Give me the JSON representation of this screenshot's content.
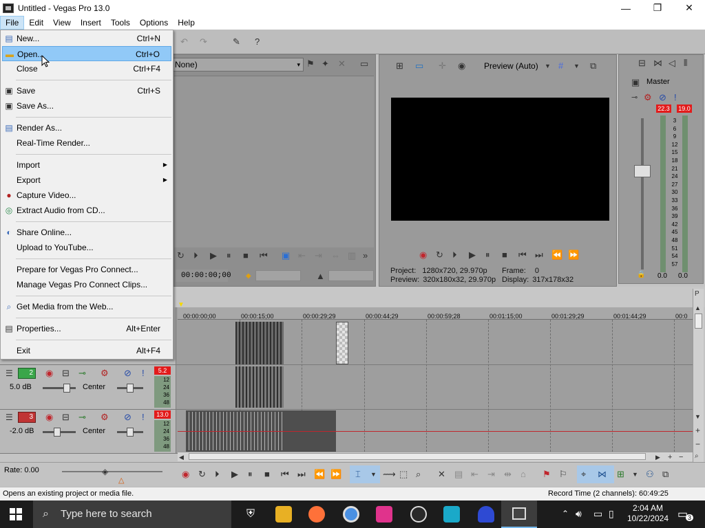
{
  "window": {
    "title": "Untitled - Vegas Pro 13.0",
    "icon": "vegas-app-icon"
  },
  "window_controls": {
    "minimize": "—",
    "maximize": "❐",
    "close": "✕"
  },
  "menubar": [
    "File",
    "Edit",
    "View",
    "Insert",
    "Tools",
    "Options",
    "Help"
  ],
  "file_menu": {
    "items": [
      {
        "label": "New...",
        "shortcut": "Ctrl+N",
        "icon": "new-file-icon"
      },
      {
        "label": "Open...",
        "shortcut": "Ctrl+O",
        "icon": "folder-open-icon",
        "highlighted": true
      },
      {
        "label": "Close",
        "shortcut": "Ctrl+F4"
      },
      {
        "label": "Save",
        "shortcut": "Ctrl+S",
        "icon": "save-icon"
      },
      {
        "label": "Save As...",
        "shortcut": "",
        "icon": "save-as-icon"
      },
      {
        "label": "Render As...",
        "shortcut": "",
        "icon": "render-icon"
      },
      {
        "label": "Real-Time Render...",
        "shortcut": ""
      },
      {
        "label": "Import",
        "shortcut": "",
        "submenu": true
      },
      {
        "label": "Export",
        "shortcut": "",
        "submenu": true
      },
      {
        "label": "Capture Video...",
        "shortcut": "",
        "icon": "capture-icon"
      },
      {
        "label": "Extract Audio from CD...",
        "shortcut": "",
        "icon": "cd-icon"
      },
      {
        "label": "Share Online...",
        "shortcut": "",
        "icon": "share-icon"
      },
      {
        "label": "Upload to YouTube...",
        "shortcut": ""
      },
      {
        "label": "Prepare for Vegas Pro Connect...",
        "shortcut": ""
      },
      {
        "label": "Manage Vegas Pro Connect Clips...",
        "shortcut": ""
      },
      {
        "label": "Get Media from the Web...",
        "shortcut": "",
        "icon": "web-icon"
      },
      {
        "label": "Properties...",
        "shortcut": "Alt+Enter",
        "icon": "properties-icon"
      },
      {
        "label": "Exit",
        "shortcut": "Alt+F4"
      }
    ]
  },
  "media_panel": {
    "effect_select": "None)"
  },
  "trimmer": {
    "timecode": "00:00:00;00"
  },
  "preview": {
    "mode": "Preview (Auto)",
    "project_label": "Project:",
    "project_value": "1280x720, 29.970p",
    "preview_label": "Preview:",
    "preview_value": "320x180x32, 29.970p",
    "frame_label": "Frame:",
    "frame_value": "0",
    "display_label": "Display:",
    "display_value": "317x178x32"
  },
  "master": {
    "title": "Master",
    "peak_left": "22.3",
    "peak_right": "19.0",
    "scale": [
      "3",
      "6",
      "9",
      "12",
      "15",
      "18",
      "21",
      "24",
      "27",
      "30",
      "33",
      "36",
      "39",
      "42",
      "45",
      "48",
      "51",
      "54",
      "57"
    ],
    "left_value": "0.0",
    "right_value": "0.0"
  },
  "ruler": {
    "labels": [
      "00:00:00;00",
      "00:00:15;00",
      "00:00:29;29",
      "00:00:44;29",
      "00:00:59;28",
      "00:01:15;00",
      "00:01:29;29",
      "00:01:44;29",
      "00:0"
    ]
  },
  "tracks": [
    {
      "number": "2",
      "volume": "5.0 dB",
      "pan": "Center",
      "peak": "5.2",
      "meter": [
        "12",
        "24",
        "36",
        "48"
      ]
    },
    {
      "number": "3",
      "volume": "-2.0 dB",
      "pan": "Center",
      "peak": "13.0",
      "meter": [
        "12",
        "24",
        "36",
        "48"
      ]
    }
  ],
  "transport": {
    "rate": "Rate: 0.00"
  },
  "status": {
    "left": "Opens an existing project or media file.",
    "right": "Record Time (2 channels): 60:49:25"
  },
  "taskbar": {
    "search_placeholder": "Type here to search",
    "time": "2:04 AM",
    "date": "10/22/2024",
    "notification_count": "3",
    "apps": [
      "security-app",
      "file-explorer",
      "firefox",
      "chrome",
      "app-pink",
      "app-gauge",
      "app-vs",
      "app-hat",
      "vegas-pro"
    ]
  },
  "colors": {
    "menu_highlight": "#91c9f7",
    "peak_red": "#e21b1b",
    "track_audio": "#3aa64a",
    "track_3": "#c03434"
  }
}
